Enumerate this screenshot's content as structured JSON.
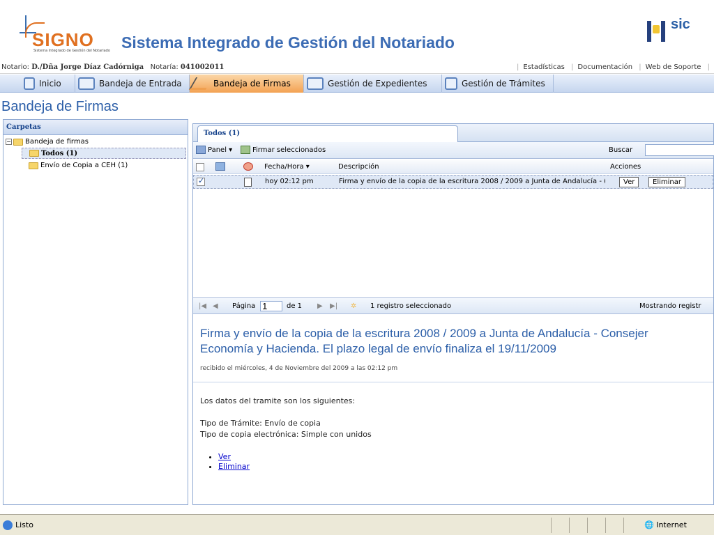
{
  "header": {
    "logo_text": "SIGNO",
    "logo_subtext": "Sistema Integrado de Gestión del Notariado",
    "app_title": "Sistema Integrado de Gestión del Notariado",
    "right_logo": "sic"
  },
  "info": {
    "notario_label": "Notario:",
    "notario_name": "D./Dña Jorge Díaz Cadórniga",
    "notaria_label": "Notaría:",
    "notaria_code": "041002011",
    "links": [
      "Estadísticas",
      "Documentación",
      "Web de Soporte"
    ]
  },
  "nav": {
    "tabs": [
      "Inicio",
      "Bandeja de Entrada",
      "Bandeja de Firmas",
      "Gestión de Expedientes",
      "Gestión de Trámites"
    ],
    "active": "Bandeja de Firmas"
  },
  "page_title": "Bandeja de Firmas",
  "left_panel": {
    "title": "Carpetas",
    "root": "Bandeja de firmas",
    "children": [
      "Todos (1)",
      "Envío de Copia a CEH (1)"
    ]
  },
  "right_panel": {
    "tab": "Todos (1)",
    "toolbar": {
      "panel": "Panel",
      "sign": "Firmar seleccionados",
      "search_label": "Buscar"
    },
    "columns": {
      "datetime": "Fecha/Hora",
      "description": "Descripción",
      "actions": "Acciones"
    },
    "rows": [
      {
        "datetime": "hoy 02:12 pm",
        "description": "Firma y envío de la copia de la escritura 2008 / 2009 a Junta de Andalucía - (",
        "view": "Ver",
        "delete": "Eliminar"
      }
    ],
    "pager": {
      "page_label": "Página",
      "page": "1",
      "of": "de 1",
      "selected": "1 registro seleccionado",
      "showing": "Mostrando registr"
    }
  },
  "detail": {
    "title_line1": "Firma y envío de la copia de la escritura 2008 / 2009 a Junta de Andalucía - Consejer",
    "title_line2": "Economía y Hacienda. El plazo legal de envío finaliza el 19/11/2009",
    "received": "recibido el miércoles, 4 de Noviembre del 2009 a las 02:12 pm",
    "intro": "Los datos del tramite son los siguientes:",
    "type_line": "Tipo de Trámite: Envío de copia",
    "copy_line": "Tipo de copia electrónica: Simple con unidos",
    "links": [
      "Ver",
      "Eliminar"
    ]
  },
  "status": {
    "left": "Listo",
    "zone": "Internet"
  }
}
